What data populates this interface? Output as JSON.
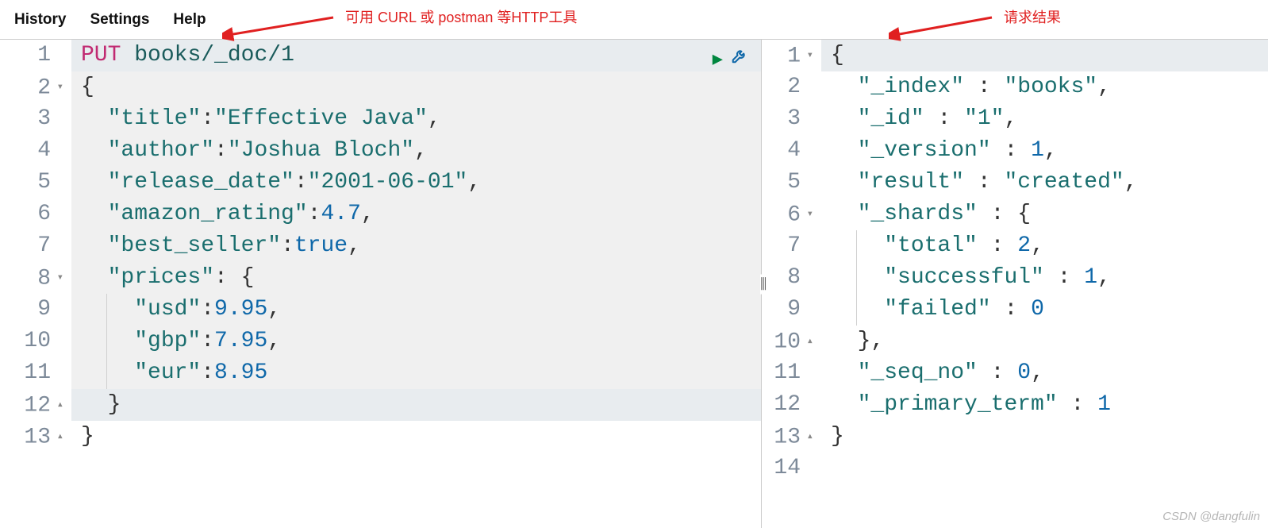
{
  "menu": {
    "history": "History",
    "settings": "Settings",
    "help": "Help"
  },
  "annotations": {
    "left": "可用 CURL 或 postman 等HTTP工具",
    "right": "请求结果"
  },
  "watermark": "CSDN @dangfulin",
  "request": {
    "method": "PUT",
    "path": "books/_doc/1",
    "lines": [
      {
        "n": "1",
        "fold": "",
        "cls": "active",
        "html": "<span class='kw'>{method}</span> <span class='path'>{path}</span>"
      },
      {
        "n": "2",
        "fold": "▾",
        "cls": "selblock",
        "html": "<span class='punc'>{</span>"
      },
      {
        "n": "3",
        "fold": "",
        "cls": "selblock",
        "html": "  <span class='str'>\"title\"</span><span class='punc'>:</span><span class='str'>\"Effective Java\"</span><span class='punc'>,</span>"
      },
      {
        "n": "4",
        "fold": "",
        "cls": "selblock",
        "html": "  <span class='str'>\"author\"</span><span class='punc'>:</span><span class='str'>\"Joshua Bloch\"</span><span class='punc'>,</span>"
      },
      {
        "n": "5",
        "fold": "",
        "cls": "selblock",
        "html": "  <span class='str'>\"release_date\"</span><span class='punc'>:</span><span class='str'>\"2001-06-01\"</span><span class='punc'>,</span>"
      },
      {
        "n": "6",
        "fold": "",
        "cls": "selblock",
        "html": "  <span class='str'>\"amazon_rating\"</span><span class='punc'>:</span><span class='num'>4.7</span><span class='punc'>,</span>"
      },
      {
        "n": "7",
        "fold": "",
        "cls": "selblock",
        "html": "  <span class='str'>\"best_seller\"</span><span class='punc'>:</span><span class='bool'>true</span><span class='punc'>,</span>"
      },
      {
        "n": "8",
        "fold": "▾",
        "cls": "selblock",
        "html": "  <span class='str'>\"prices\"</span><span class='punc'>: {</span>"
      },
      {
        "n": "9",
        "fold": "",
        "cls": "selblock",
        "html": "    <span class='str'>\"usd\"</span><span class='punc'>:</span><span class='num'>9.95</span><span class='punc'>,</span>",
        "guide": 44
      },
      {
        "n": "10",
        "fold": "",
        "cls": "selblock",
        "html": "    <span class='str'>\"gbp\"</span><span class='punc'>:</span><span class='num'>7.95</span><span class='punc'>,</span>",
        "guide": 44
      },
      {
        "n": "11",
        "fold": "",
        "cls": "selblock",
        "html": "    <span class='str'>\"eur\"</span><span class='punc'>:</span><span class='num'>8.95</span>",
        "guide": 44
      },
      {
        "n": "12",
        "fold": "▴",
        "cls": "active",
        "html": "  <span class='punc'>}</span>"
      },
      {
        "n": "13",
        "fold": "▴",
        "cls": "",
        "html": "<span class='punc'>}</span>"
      }
    ]
  },
  "response": {
    "lines": [
      {
        "n": "1",
        "fold": "▾",
        "cls": "active",
        "html": "<span class='punc'>{</span>"
      },
      {
        "n": "2",
        "fold": "",
        "cls": "",
        "html": "  <span class='str'>\"_index\"</span> <span class='punc'>:</span> <span class='str'>\"books\"</span><span class='punc'>,</span>"
      },
      {
        "n": "3",
        "fold": "",
        "cls": "",
        "html": "  <span class='str'>\"_id\"</span> <span class='punc'>:</span> <span class='str'>\"1\"</span><span class='punc'>,</span>"
      },
      {
        "n": "4",
        "fold": "",
        "cls": "",
        "html": "  <span class='str'>\"_version\"</span> <span class='punc'>:</span> <span class='num'>1</span><span class='punc'>,</span>"
      },
      {
        "n": "5",
        "fold": "",
        "cls": "",
        "html": "  <span class='str'>\"result\"</span> <span class='punc'>:</span> <span class='str'>\"created\"</span><span class='punc'>,</span>"
      },
      {
        "n": "6",
        "fold": "▾",
        "cls": "",
        "html": "  <span class='str'>\"_shards\"</span> <span class='punc'>:</span> <span class='punc'>{</span>"
      },
      {
        "n": "7",
        "fold": "",
        "cls": "",
        "html": "    <span class='str'>\"total\"</span> <span class='punc'>:</span> <span class='num'>2</span><span class='punc'>,</span>",
        "guide": 44
      },
      {
        "n": "8",
        "fold": "",
        "cls": "",
        "html": "    <span class='str'>\"successful\"</span> <span class='punc'>:</span> <span class='num'>1</span><span class='punc'>,</span>",
        "guide": 44
      },
      {
        "n": "9",
        "fold": "",
        "cls": "",
        "html": "    <span class='str'>\"failed\"</span> <span class='punc'>:</span> <span class='num'>0</span>",
        "guide": 44
      },
      {
        "n": "10",
        "fold": "▴",
        "cls": "",
        "html": "  <span class='punc'>},</span>"
      },
      {
        "n": "11",
        "fold": "",
        "cls": "",
        "html": "  <span class='str'>\"_seq_no\"</span> <span class='punc'>:</span> <span class='num'>0</span><span class='punc'>,</span>"
      },
      {
        "n": "12",
        "fold": "",
        "cls": "",
        "html": "  <span class='str'>\"_primary_term\"</span> <span class='punc'>:</span> <span class='num'>1</span>"
      },
      {
        "n": "13",
        "fold": "▴",
        "cls": "",
        "html": "<span class='punc'>}</span>"
      },
      {
        "n": "14",
        "fold": "",
        "cls": "",
        "html": ""
      }
    ]
  }
}
